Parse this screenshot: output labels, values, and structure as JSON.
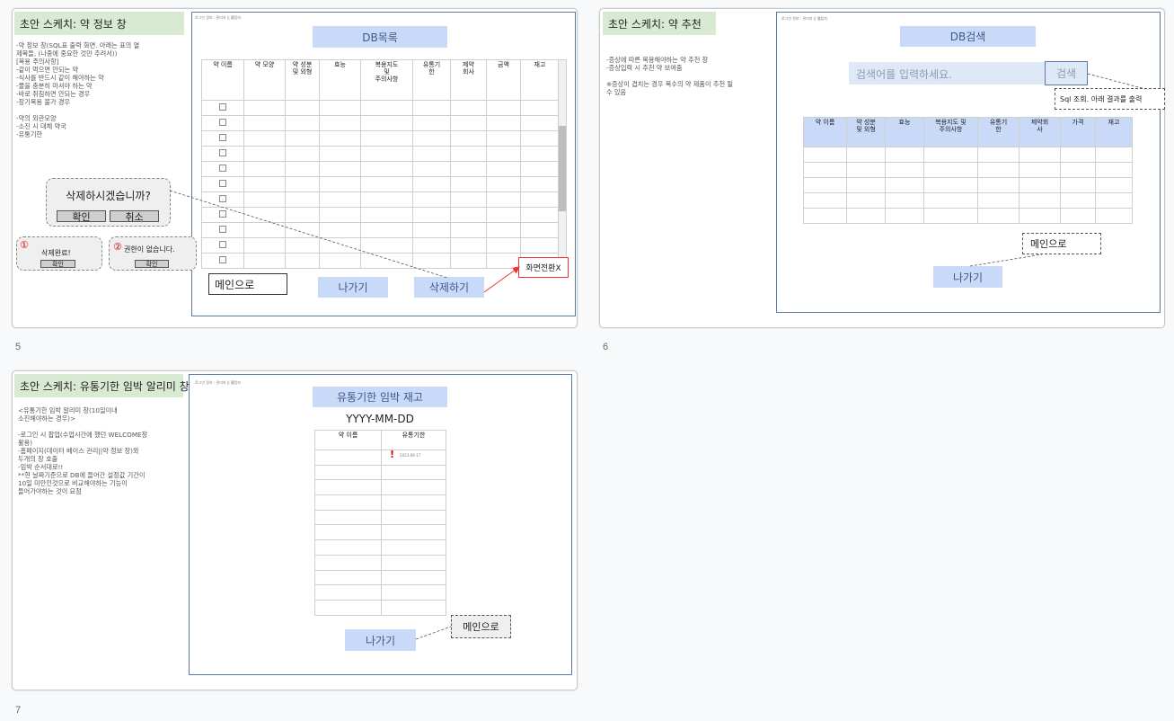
{
  "slides": [
    {
      "number": "5",
      "title": "초안 스케치: 약 정보 창",
      "notes": "-약 정보 창(SQL표 출력 화면. 아래는 표의 열\n제목들, (나중에 중요한 것만 추려서))\n       [복용 주의사항]\n       -같이 먹으면 안되는 약\n       -식사를 반드시 같이 해야하는 약\n       -물을 충분히 마셔야 하는 약\n       -바로 취침하면 안되는 경우\n       -장기복용 불가 경우\n\n       -약의 외관모양\n       -소진 시 대체 약국\n       -유통기한",
      "header_tiny": "로그인 정보 : 관리자 || 웰컴자",
      "screen_title": "DB목록",
      "table_headers": [
        "약 이름",
        "약 모양",
        "약 성분\n및 외형",
        "효능",
        "복용지도\n및\n주의사항",
        "유통기\n한",
        "제약\n회사",
        "금액",
        "재고"
      ],
      "row_count": 11,
      "dialog_text": "삭제하시겠습니까?",
      "dialog_ok": "확인",
      "dialog_cancel": "취소",
      "result1_marker": "①",
      "result1_text": "삭제완료!",
      "result1_btn": "확인",
      "result2_marker": "②",
      "result2_text": "권한이 없습니다.",
      "result2_btn": "확인",
      "main_btn": "메인으로",
      "exit_btn": "나가기",
      "delete_btn": "삭제하기",
      "note_box": "화면전환X"
    },
    {
      "number": "6",
      "title": "초안 스케치: 약 추천",
      "notes": "-증상에 따른 복용해야하는 약 추천 창\n-증상입력 시 추천 약 보여줌\n\n※증상이 겹치는 경우 복수의 약 제품이 추천 될\n수 있음",
      "header_tiny": "로그인 정보 : 관리자 || 웰컴자",
      "screen_title": "DB검색",
      "search_placeholder": "검색어를 입력하세요.",
      "search_btn": "검색",
      "sql_note": "Sql 조회. 아래 결과를 출력",
      "table_headers": [
        "약 이름",
        "약 성분\n및 외형",
        "효능",
        "복용지도 및\n주의사항",
        "유통기\n한",
        "제약회\n사",
        "가격",
        "재고"
      ],
      "row_count": 5,
      "main_btn": "메인으로",
      "exit_btn": "나가기"
    },
    {
      "number": "7",
      "title": "초안 스케치: 유통기한 임박 알리미 창",
      "notes": "<유통기한 임박 알리미 창(10일이내\n소진해야하는 경우)>\n\n-로그인 시 팝업(수업시간에 했던 WELCOME창\n활용)\n-홈페이지(데이터 베이스 관리||약 정보 창)와\n두개의 창 호출\n-임박 순서대로!!\n**현 날짜기준으로 DB에 들어간 설정값 기간이\n10일 미만인것으로 비교해야하는 기능이\n들어가야하는 것이 요점",
      "header_tiny": "로그인 정보 : 관리자 || 웰컴자",
      "screen_title": "유통기한 임박 재고",
      "date_text": "YYYY-MM-DD",
      "table_headers": [
        "약 이름",
        "유통기한"
      ],
      "row_count": 11,
      "alert_icon": "!",
      "alert_date": "2023-06-17",
      "main_btn": "메인으로",
      "exit_btn": "나가기"
    }
  ]
}
